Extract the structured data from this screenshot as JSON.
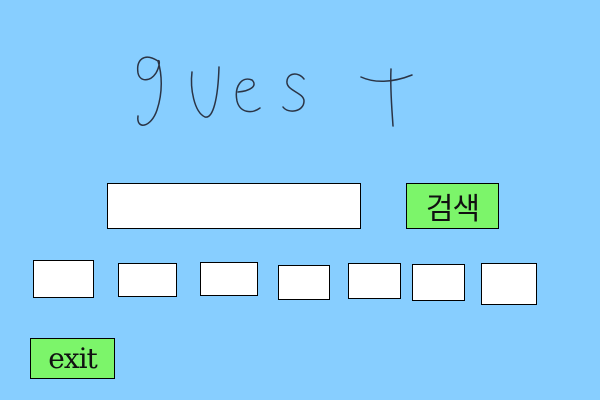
{
  "page": {
    "background_color": "#87ceff",
    "title": "guest"
  },
  "search": {
    "input_value": "",
    "button_label": "검색",
    "button_color": "#7cf56a"
  },
  "slots": [
    {
      "value": ""
    },
    {
      "value": ""
    },
    {
      "value": ""
    },
    {
      "value": ""
    },
    {
      "value": ""
    },
    {
      "value": ""
    },
    {
      "value": ""
    }
  ],
  "exit": {
    "button_label": "exit",
    "button_color": "#7cf56a"
  }
}
